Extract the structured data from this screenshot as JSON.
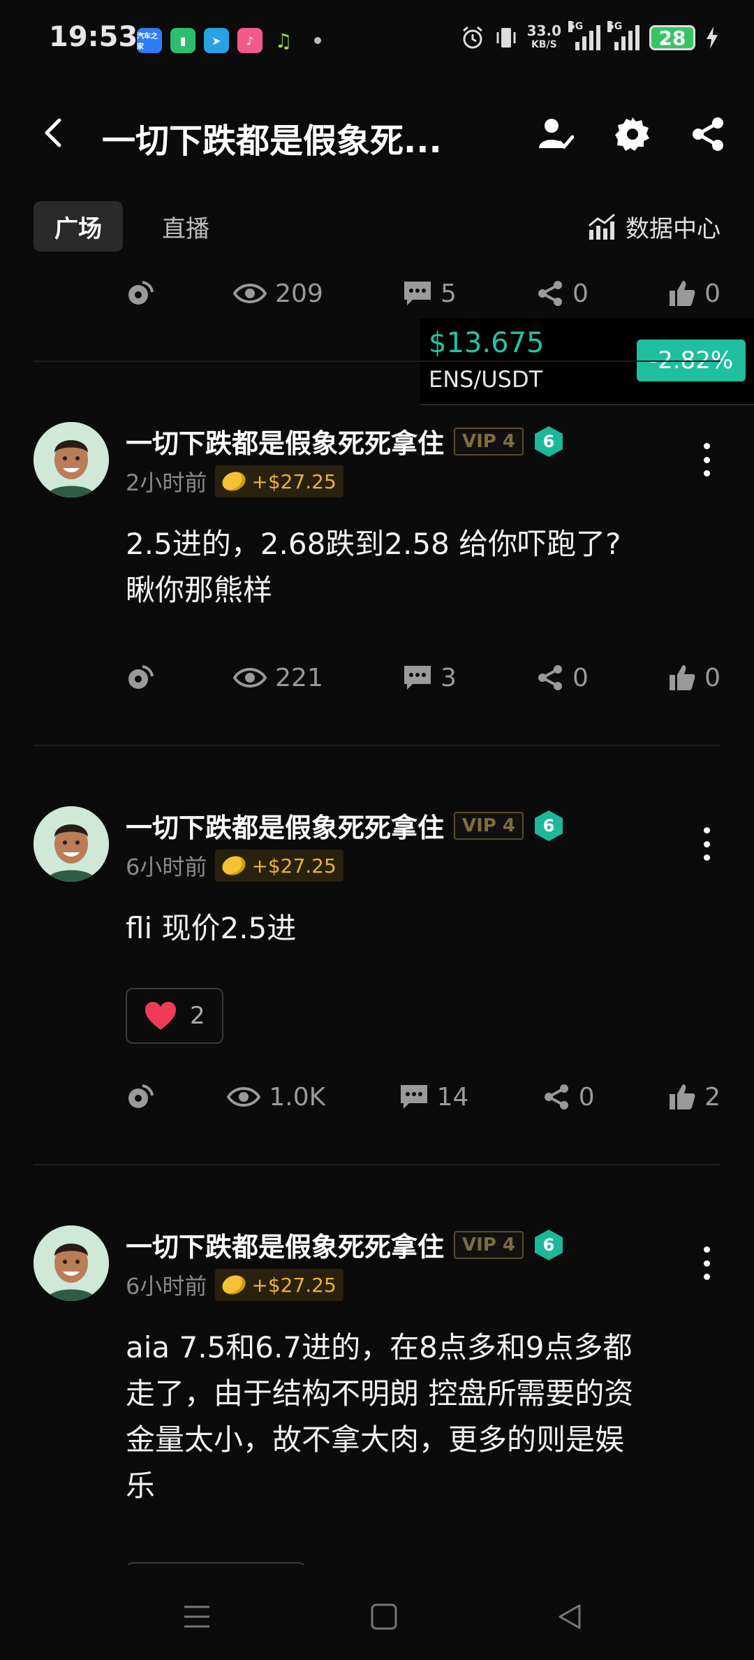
{
  "status_bar": {
    "time": "19:53",
    "net_speed": "33.0",
    "net_speed_unit": "KB/S",
    "sim1_tag": "5G",
    "sim2_tag": "5G",
    "battery": "28",
    "app_icons": [
      "汽车之家",
      "battery-saver-app",
      "telegram-app",
      "music-app",
      "music-note-app"
    ]
  },
  "header": {
    "title": "一切下跌都是假象死...",
    "icons": [
      "back-icon",
      "follow-user-icon",
      "settings-icon",
      "share-icon"
    ]
  },
  "tabs": [
    {
      "label": "广场",
      "active": true
    },
    {
      "label": "直播",
      "active": false
    }
  ],
  "data_center_label": "数据中心",
  "top_stats": {
    "views": "209",
    "comments": "5",
    "shares": "0",
    "likes": "0"
  },
  "price_card": {
    "price": "$13.675",
    "pair": "ENS/USDT",
    "change": "-2.82%",
    "price_color": "#22c3a6",
    "badge_color": "#1fbfa0"
  },
  "posts": [
    {
      "author": "一切下跌都是假象死死拿住",
      "vip": "VIP 4",
      "level": "6",
      "time": "2小时前",
      "pnl": "+$27.25",
      "content_lines": [
        "2.5进的，2.68跌到2.58 给你吓跑了?",
        "瞅你那熊样"
      ],
      "stats": {
        "views": "221",
        "comments": "3",
        "shares": "0",
        "likes": "0"
      }
    },
    {
      "author": "一切下跌都是假象死死拿住",
      "vip": "VIP 4",
      "level": "6",
      "time": "6小时前",
      "pnl": "+$27.25",
      "content_lines": [
        "fli  现价2.5进"
      ],
      "reaction_count": "2",
      "stats": {
        "views": "1.0K",
        "comments": "14",
        "shares": "0",
        "likes": "2"
      }
    },
    {
      "author": "一切下跌都是假象死死拿住",
      "vip": "VIP 4",
      "level": "6",
      "time": "6小时前",
      "pnl": "+$27.25",
      "content_lines": [
        "aia  7.5和6.7进的，在8点多和9点多都",
        "走了，由于结构不明朗 控盘所需要的资",
        "金量太小，故不拿大肉，更多的则是娱",
        "乐"
      ]
    }
  ],
  "colors": {
    "background": "#0b0b0b",
    "accent": "#1fbfa0",
    "gold": "#e8b339"
  }
}
